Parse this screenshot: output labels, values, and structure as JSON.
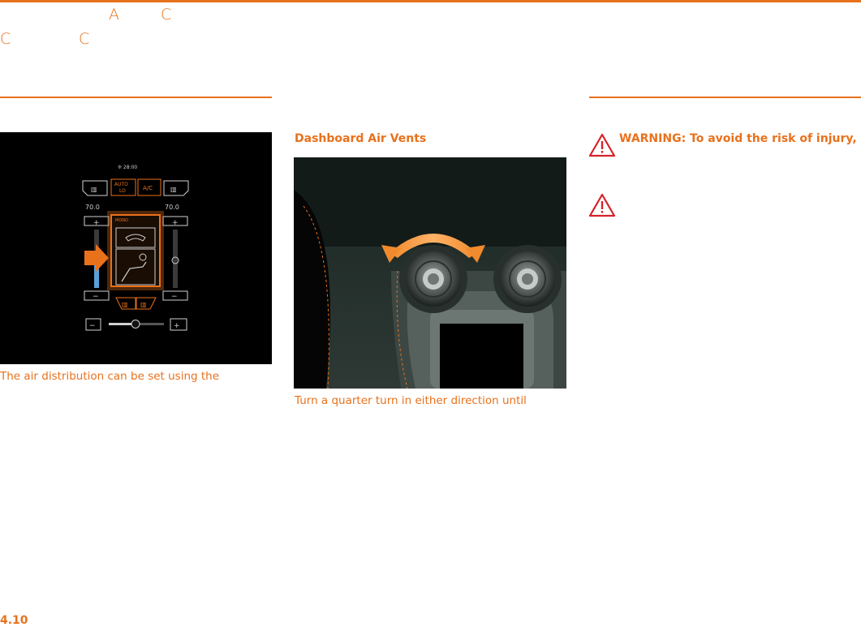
{
  "header": {
    "glyphs": [
      "A",
      "C",
      "C",
      "C"
    ],
    "accent_color": "#e8711c"
  },
  "left_column": {
    "screen": {
      "fan_readout": "❊ 28:00",
      "auto_label": "AUTO",
      "auto_sub": "LO",
      "ac_label": "A/C",
      "temp_left": "70.0",
      "temp_right": "70.0",
      "mono_label": "MONO",
      "plus": "+",
      "minus": "−"
    },
    "caption": "The air distribution can be set using the"
  },
  "middle_column": {
    "heading": "Dashboard Air Vents",
    "caption": "Turn a quarter turn in either direction until"
  },
  "right_column": {
    "warning_text": "WARNING: To avoid the risk of injury,",
    "warning_color": "#d6232a"
  },
  "footer": {
    "page_number": "4.10"
  }
}
